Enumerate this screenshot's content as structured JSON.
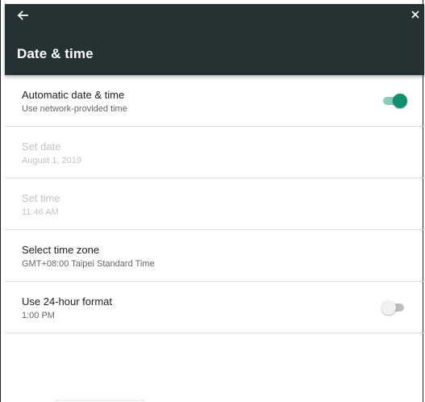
{
  "appbar": {
    "title": "Date & time",
    "bg_color": "#263133",
    "icons": {
      "back": "arrow-left-icon",
      "close": "close-icon"
    }
  },
  "settings": [
    {
      "title": "Automatic date & time",
      "subtitle": "Use network-provided time",
      "enabled": true,
      "toggle": "on"
    },
    {
      "title": "Set date",
      "subtitle": "August 1, 2019",
      "enabled": false
    },
    {
      "title": "Set time",
      "subtitle": "11:46 AM",
      "enabled": false
    },
    {
      "title": "Select time zone",
      "subtitle": "GMT+08:00 Taipei Standard Time",
      "enabled": true
    },
    {
      "title": "Use 24-hour format",
      "subtitle": "1:00 PM",
      "enabled": true,
      "toggle": "off"
    }
  ],
  "colors": {
    "accent": "#118e6e",
    "accent_track": "#87cdb9",
    "disabled_text": "#c2c2c2"
  }
}
